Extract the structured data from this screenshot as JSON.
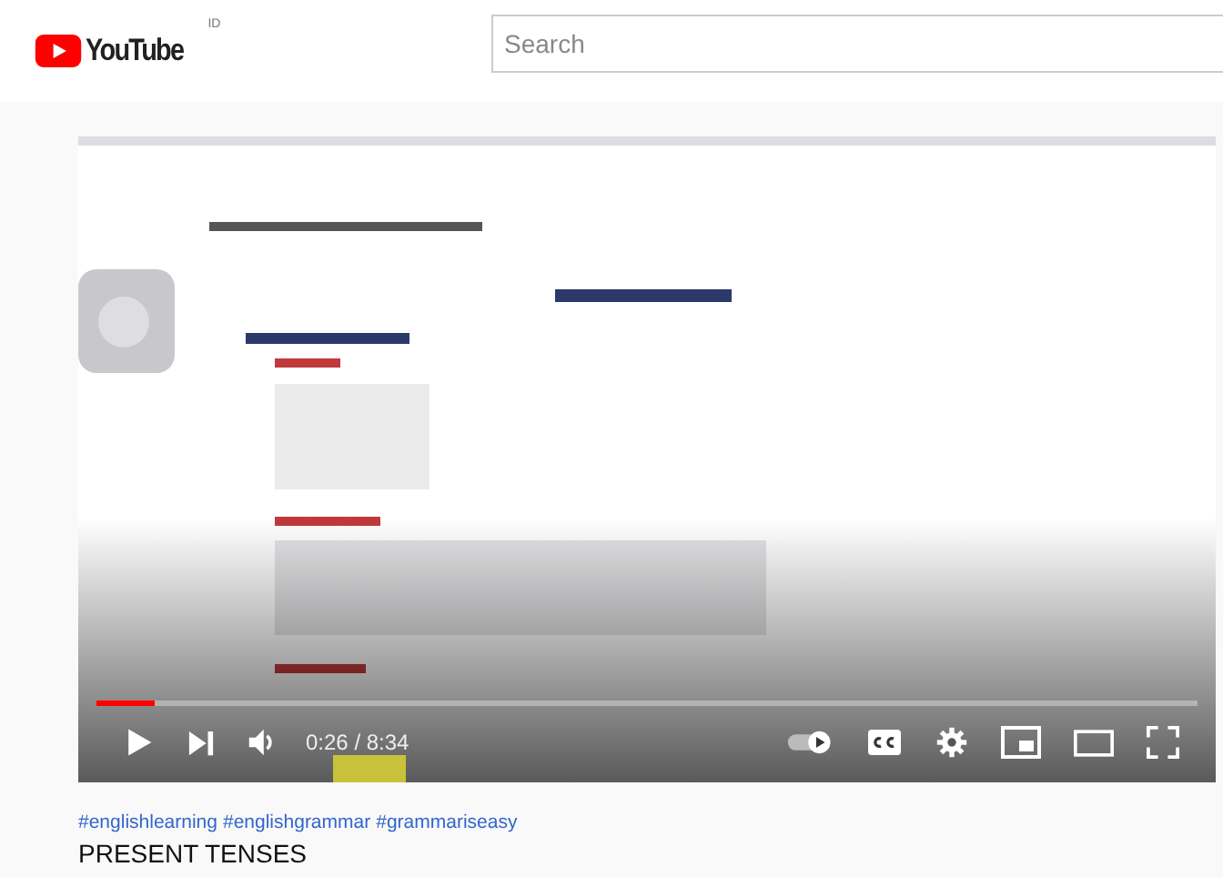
{
  "header": {
    "logo_text": "YouTube",
    "logo_badge": "ID",
    "search": {
      "placeholder": "Search"
    }
  },
  "player": {
    "progress": {
      "level": 0.053
    },
    "playing": false,
    "time": "0:26 / 8:34",
    "autoplay": true
  },
  "video": {
    "hashtags": [
      "#englishlearning",
      "#englishgrammar",
      "#grammariseasy"
    ],
    "title": "PRESENT TENSES"
  }
}
